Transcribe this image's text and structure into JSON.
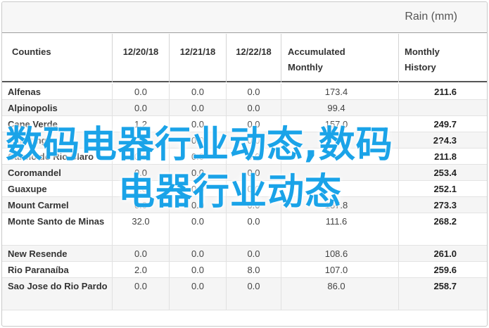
{
  "title": "Rain (mm)",
  "headers": {
    "county": "Counties",
    "d1": "12/20/18",
    "d2": "12/21/18",
    "d3": "12/22/18",
    "accumulated": "Accumulated Monthly",
    "history": "Monthly History"
  },
  "rows": [
    {
      "county": "Alfenas",
      "d1": "0.0",
      "d2": "0.0",
      "d3": "0.0",
      "accumulated": "173.4",
      "history": "211.6"
    },
    {
      "county": "Alpinopolis",
      "d1": "0.0",
      "d2": "0.0",
      "d3": "0.0",
      "accumulated": "99.4",
      "history": ""
    },
    {
      "county": "Cape Verde",
      "d1": "1.2",
      "d2": "0.0",
      "d3": "0.0",
      "accumulated": "157.0",
      "history": "249.7"
    },
    {
      "county": "Capetinga",
      "d1": "0.2",
      "d2": "0.0",
      "d3": "0.0",
      "accumulated": "",
      "history": "2?4.3"
    },
    {
      "county": "Carmo do Rio Claro",
      "d1": "0.0",
      "d2": "0.0",
      "d3": "0.0",
      "accumulated": "",
      "history": "211.8"
    },
    {
      "county": "Coromandel",
      "d1": "0.0",
      "d2": "0.0",
      "d3": "0.0",
      "accumulated": "",
      "history": "253.4"
    },
    {
      "county": "Guaxupe",
      "d1": "0.0",
      "d2": "0.0",
      "d3": "0.0",
      "accumulated": "",
      "history": "252.1"
    },
    {
      "county": "Mount Carmel",
      "d1": "0.0",
      "d2": "0.0",
      "d3": "0.0",
      "accumulated": "187.8",
      "history": "273.3"
    },
    {
      "county": "Monte Santo de Minas",
      "d1": "32.0",
      "d2": "0.0",
      "d3": "0.0",
      "accumulated": "111.6",
      "history": "268.2"
    },
    {
      "county": "New Resende",
      "d1": "0.0",
      "d2": "0.0",
      "d3": "0.0",
      "accumulated": "108.6",
      "history": "261.0"
    },
    {
      "county": "Rio Paranaíba",
      "d1": "2.0",
      "d2": "0.0",
      "d3": "8.0",
      "accumulated": "107.0",
      "history": "259.6"
    },
    {
      "county": "Sao Jose do Rio Pardo",
      "d1": "0.0",
      "d2": "0.0",
      "d3": "0.0",
      "accumulated": "86.0",
      "history": "258.7"
    }
  ],
  "watermark": {
    "line1": "数码电器行业动态,数码",
    "line2": "电器行业动态"
  }
}
